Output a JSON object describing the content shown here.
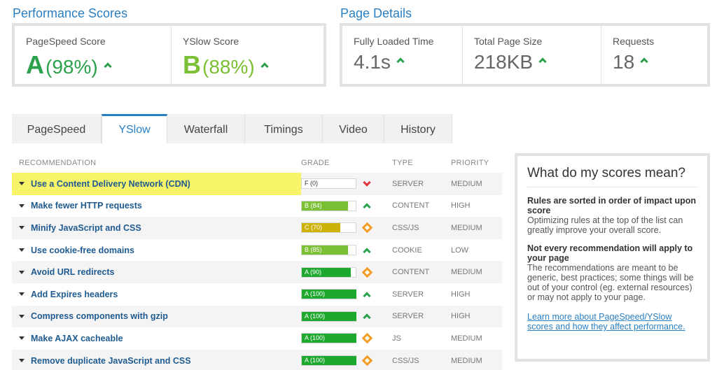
{
  "performance": {
    "title": "Performance Scores",
    "pagespeed": {
      "label": "PageSpeed Score",
      "grade": "A",
      "percent": "(98%)"
    },
    "yslow": {
      "label": "YSlow Score",
      "grade": "B",
      "percent": "(88%)"
    }
  },
  "details": {
    "title": "Page Details",
    "loaded": {
      "label": "Fully Loaded Time",
      "value": "4.1s"
    },
    "size": {
      "label": "Total Page Size",
      "value": "218KB"
    },
    "requests": {
      "label": "Requests",
      "value": "18"
    }
  },
  "tabs": [
    "PageSpeed",
    "YSlow",
    "Waterfall",
    "Timings",
    "Video",
    "History"
  ],
  "active_tab": "YSlow",
  "table": {
    "headers": {
      "recommendation": "RECOMMENDATION",
      "grade": "GRADE",
      "type": "TYPE",
      "priority": "PRIORITY"
    },
    "rows": [
      {
        "name": "Use a Content Delivery Network (CDN)",
        "grade": "F (0)",
        "score": 0,
        "color": "#e2333b",
        "trend": "down",
        "type": "SERVER",
        "priority": "MEDIUM",
        "highlight": true
      },
      {
        "name": "Make fewer HTTP requests",
        "grade": "B (84)",
        "score": 84,
        "color": "#7bbf34",
        "trend": "up",
        "type": "CONTENT",
        "priority": "HIGH"
      },
      {
        "name": "Minify JavaScript and CSS",
        "grade": "C (70)",
        "score": 70,
        "color": "#cdb20a",
        "trend": "neutral",
        "type": "CSS/JS",
        "priority": "MEDIUM"
      },
      {
        "name": "Use cookie-free domains",
        "grade": "B (85)",
        "score": 85,
        "color": "#7bbf34",
        "trend": "up",
        "type": "COOKIE",
        "priority": "LOW"
      },
      {
        "name": "Avoid URL redirects",
        "grade": "A (90)",
        "score": 90,
        "color": "#1fa830",
        "trend": "neutral",
        "type": "CONTENT",
        "priority": "MEDIUM"
      },
      {
        "name": "Add Expires headers",
        "grade": "A (100)",
        "score": 100,
        "color": "#1fa830",
        "trend": "up",
        "type": "SERVER",
        "priority": "HIGH"
      },
      {
        "name": "Compress components with gzip",
        "grade": "A (100)",
        "score": 100,
        "color": "#1fa830",
        "trend": "up",
        "type": "SERVER",
        "priority": "HIGH"
      },
      {
        "name": "Make AJAX cacheable",
        "grade": "A (100)",
        "score": 100,
        "color": "#1fa830",
        "trend": "neutral",
        "type": "JS",
        "priority": "MEDIUM"
      },
      {
        "name": "Remove duplicate JavaScript and CSS",
        "grade": "A (100)",
        "score": 100,
        "color": "#1fa830",
        "trend": "neutral",
        "type": "CSS/JS",
        "priority": "MEDIUM"
      }
    ]
  },
  "help": {
    "title": "What do my scores mean?",
    "h1": "Rules are sorted in order of impact upon score",
    "p1": "Optimizing rules at the top of the list can greatly improve your overall score.",
    "h2": "Not every recommendation will apply to your page",
    "p2": "The recommendations are meant to be generic, best practices; some things will be out of your control (eg. external resources) or may not apply to your page.",
    "link": "Learn more about PageSpeed/YSlow scores and how they affect performance."
  },
  "colors": {
    "accent": "#2a7fc1",
    "grade_a": "#2aa14a",
    "grade_b": "#7bbf34",
    "link": "#1f5b90"
  }
}
